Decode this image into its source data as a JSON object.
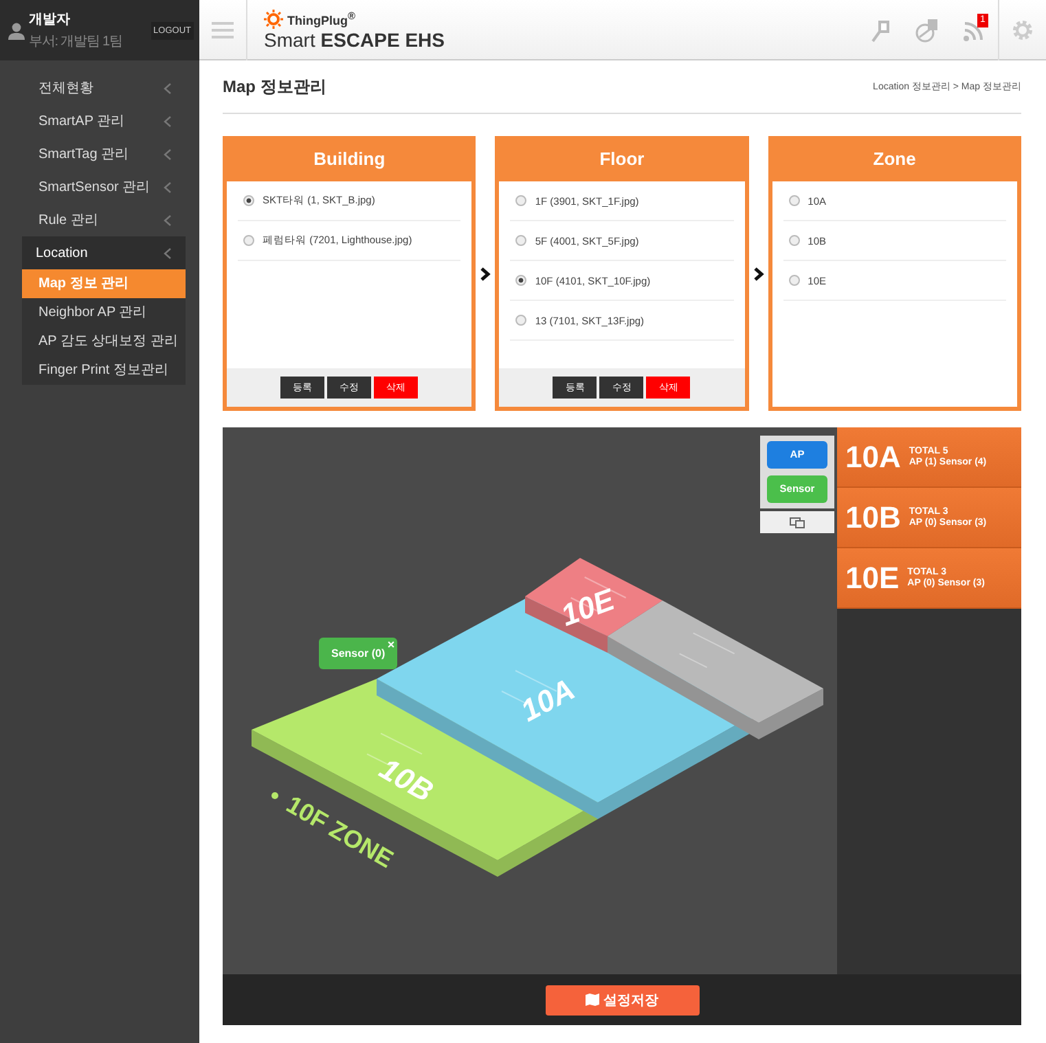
{
  "user": {
    "name": "개발자",
    "department": "부서: 개발팀 1팀"
  },
  "logout": "LOGOUT",
  "menu": [
    {
      "label": "전체현황",
      "expanded": false
    },
    {
      "label": "SmartAP 관리",
      "expanded": false
    },
    {
      "label": "SmartTag 관리",
      "expanded": false
    },
    {
      "label": "SmartSensor 관리",
      "expanded": false
    },
    {
      "label": "Rule 관리",
      "expanded": false
    },
    {
      "label": "Location",
      "expanded": true,
      "children": [
        {
          "label": "Map 정보 관리",
          "selected": true
        },
        {
          "label": "Neighbor AP 관리",
          "selected": false
        },
        {
          "label": "AP 감도 상대보정 관리",
          "selected": false
        },
        {
          "label": "Finger Print 정보관리",
          "selected": false
        }
      ]
    }
  ],
  "brand": {
    "name": "ThingPlug$^{®}$",
    "product": "Smart **ESCAPE EHS**"
  },
  "header_icons": [
    {
      "kind": "pin"
    },
    {
      "kind": "tag"
    },
    {
      "kind": "signal",
      "badge": "1"
    }
  ],
  "page_title": "Map 정보관리",
  "breadcrumb": "Location 정보관리 > Map 정보관리",
  "panels": [
    {
      "title": "Building",
      "items": [
        {
          "label": "SKT타워 (1, SKT_B.jpg)",
          "selected": true
        },
        {
          "label": "페럼타워 (7201, Lighthouse.jpg)",
          "selected": false
        }
      ],
      "buttons": [
        {
          "label": "등록",
          "kind": "dark"
        },
        {
          "label": "수정",
          "kind": "dark"
        },
        {
          "label": "삭제",
          "kind": "danger"
        }
      ]
    },
    {
      "title": "Floor",
      "items": [
        {
          "label": "1F (3901, SKT_1F.jpg)",
          "selected": false
        },
        {
          "label": "5F (4001, SKT_5F.jpg)",
          "selected": false
        },
        {
          "label": "10F (4101, SKT_10F.jpg)",
          "selected": true
        },
        {
          "label": "13 (7101, SKT_13F.jpg)",
          "selected": false
        }
      ],
      "buttons": [
        {
          "label": "등록",
          "kind": "dark"
        },
        {
          "label": "수정",
          "kind": "dark"
        },
        {
          "label": "삭제",
          "kind": "danger"
        }
      ]
    },
    {
      "title": "Zone",
      "items": [
        {
          "label": "10A",
          "selected": false
        },
        {
          "label": "10B",
          "selected": false
        },
        {
          "label": "10E",
          "selected": false
        }
      ]
    }
  ],
  "map": {
    "zones": [
      {
        "label": "10B",
        "color": "#b5e86a"
      },
      {
        "label": "10A",
        "color": "#7fd6ee"
      },
      {
        "label": "10E",
        "color": "#ee7f84"
      },
      {
        "color": "#b9b9b9"
      }
    ],
    "floor_label": "10F ZONE",
    "sensor_popup": {
      "label": "Sensor (0)",
      "close": "×"
    }
  },
  "legend": [
    {
      "label": "AP",
      "color": "#1e7fe0"
    },
    {
      "label": "Sensor",
      "color": "#4bbf4b"
    }
  ],
  "zone_summary": [
    {
      "zone": "10A",
      "total": "TOTAL 5",
      "detail": "AP (1) Sensor (4)"
    },
    {
      "zone": "10B",
      "total": "TOTAL 3",
      "detail": "AP (0) Sensor (3)"
    },
    {
      "zone": "10E",
      "total": "TOTAL 3",
      "detail": "AP (0) Sensor (3)"
    }
  ],
  "save_button": "설정저장"
}
